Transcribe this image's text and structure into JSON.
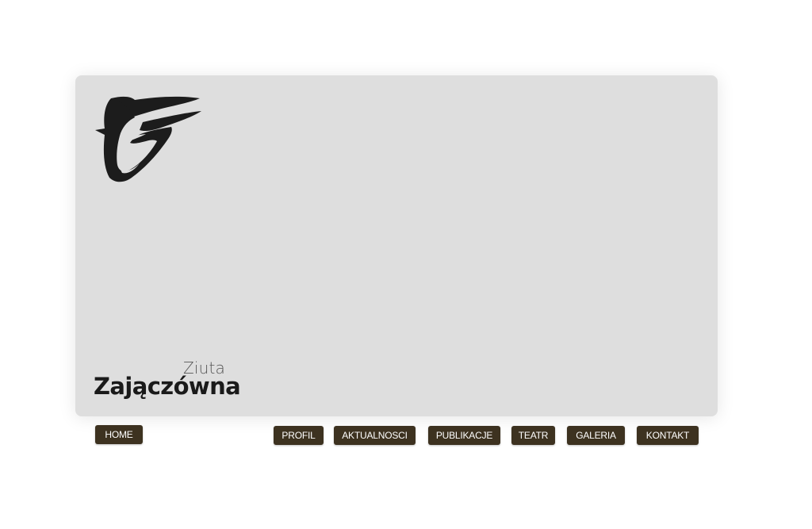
{
  "brand": {
    "first_name": "Ziuta",
    "last_name": "Zajączówna",
    "logo_icon": "stylized-face-logo-icon"
  },
  "nav": {
    "home": "HOME",
    "items": [
      {
        "label": "PROFIL"
      },
      {
        "label": "AKTUALNOSCI"
      },
      {
        "label": "PUBLIKACJE"
      },
      {
        "label": "TEATR"
      },
      {
        "label": "GALERIA"
      },
      {
        "label": "KONTAKT"
      }
    ]
  },
  "colors": {
    "panel_background": "#dedede",
    "button_background": "#3d3220",
    "button_text": "#ffffff",
    "page_background": "#ffffff"
  }
}
